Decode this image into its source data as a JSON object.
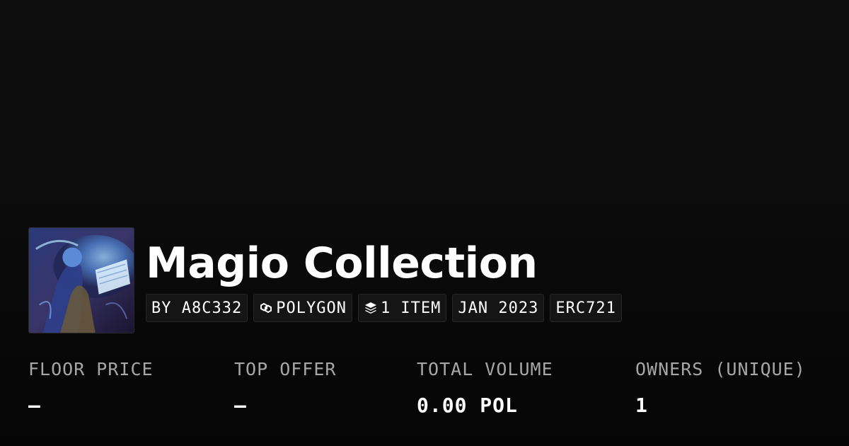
{
  "collection": {
    "title": "Magio Collection",
    "avatar_alt": "collection-artwork"
  },
  "tags": {
    "creator": "BY A8C332",
    "chain": "POLYGON",
    "chain_icon": "polygon-link-icon",
    "items": "1 ITEM",
    "items_icon": "layers-icon",
    "date": "JAN 2023",
    "standard": "ERC721"
  },
  "stats": {
    "floor_label": "FLOOR PRICE",
    "floor_value": "–",
    "offer_label": "TOP OFFER",
    "offer_value": "–",
    "volume_label": "TOTAL VOLUME",
    "volume_value": "0.00 POL",
    "owners_label": "OWNERS (UNIQUE)",
    "owners_value": "1"
  },
  "colors": {
    "background": "#0b0b0b",
    "label": "#a6a6a6",
    "text": "#ffffff",
    "tag_bg": "#151515"
  }
}
